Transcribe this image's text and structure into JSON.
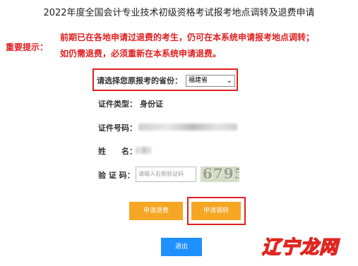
{
  "page_title": "2022年度全国会计专业技术初级资格考试报考地点调转及退费申请",
  "notice": {
    "label": "重要提示：",
    "line1": "前期已在各地申请过退费的考生，仍可在本系统申请报考地点调转；",
    "line2": "如仍需退费，必须重新在本系统申请退费。"
  },
  "province": {
    "label": "请选择您原报考的省份：",
    "selected": "福建省"
  },
  "fields": {
    "id_type_label": "证件类型：",
    "id_type_value": "身份证",
    "id_number_label": "证件号码：",
    "name_label": "姓　　名：",
    "captcha_label": "验 证 码："
  },
  "captcha": {
    "placeholder": "请输入右侧验证码",
    "image_text": "6795"
  },
  "buttons": {
    "refund": "申请退费",
    "transfer": "申请调转",
    "exit": "退出"
  },
  "watermark": "辽宁龙网",
  "colors": {
    "alert_red": "#e02020",
    "button_orange": "#f5a623",
    "button_blue": "#1e90ff"
  }
}
